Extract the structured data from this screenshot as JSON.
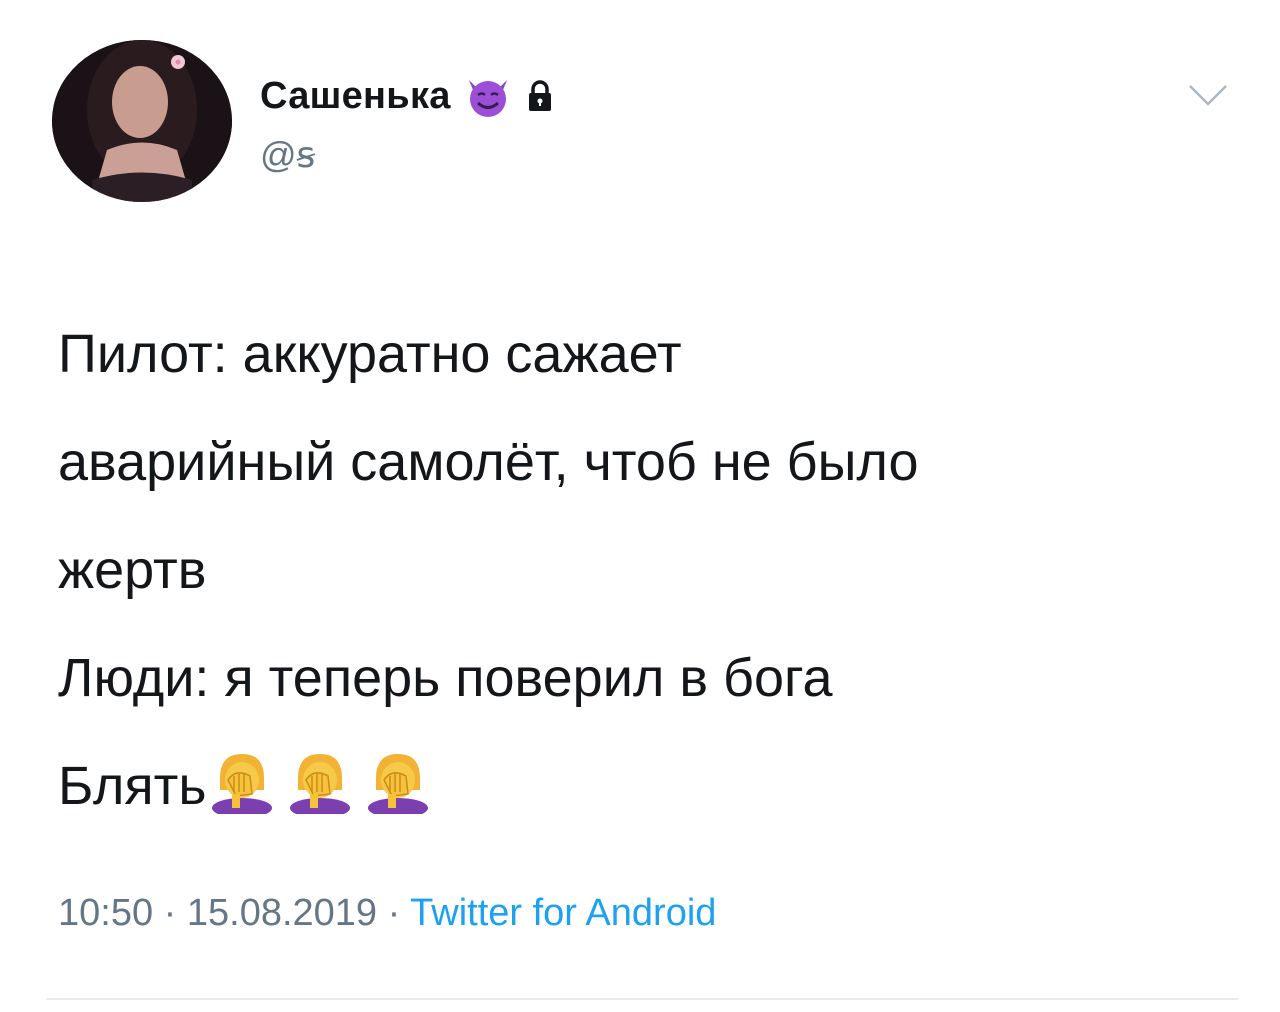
{
  "tweet": {
    "author": {
      "display_name": "Сашенька",
      "handle": "@ꞩ",
      "badge_icon": "smiling-devil-icon",
      "protected_icon": "lock-icon"
    },
    "menu_icon": "chevron-down-icon",
    "text_lines": [
      "Пилот: аккуратно сажает",
      "аварийный самолёт, чтоб не было",
      "жертв",
      "Люди: я теперь поверил в бога",
      "Блять"
    ],
    "trailing_emoji": [
      "facepalm-woman-icon",
      "facepalm-woman-icon",
      "facepalm-woman-icon"
    ],
    "meta": {
      "time": "10:50",
      "separator": " · ",
      "date": "15.08.2019",
      "source": "Twitter for Android"
    },
    "colors": {
      "text": "#14171a",
      "secondary": "#657786",
      "link": "#1da1f2",
      "divider": "#e6ecf0"
    }
  }
}
